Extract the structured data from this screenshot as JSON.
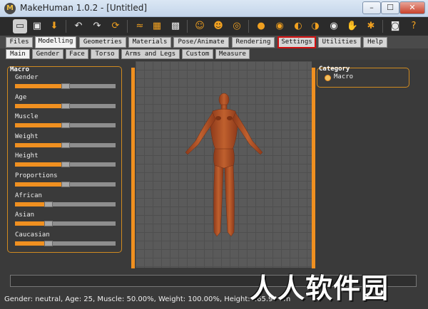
{
  "window": {
    "title": "MakeHuman 1.0.2 - [Untitled]",
    "min": "–",
    "max": "☐",
    "close": "✕"
  },
  "toolbar": {
    "icons": [
      "new-icon",
      "save-icon",
      "export-icon",
      "undo-icon",
      "redo-icon",
      "reset-icon",
      "wireframe-icon",
      "mesh-icon",
      "checker-icon",
      "front-view-icon",
      "side-view-icon",
      "top-view-icon",
      "head-icon",
      "face-icon",
      "ear-icon",
      "eye-icon",
      "hand-icon",
      "pose-icon",
      "camera-icon",
      "help-icon"
    ]
  },
  "main_tabs": [
    "Files",
    "Modelling",
    "Geometries",
    "Materials",
    "Pose/Animate",
    "Rendering",
    "Settings",
    "Utilities",
    "Help"
  ],
  "sub_tabs": [
    "Main",
    "Gender",
    "Face",
    "Torso",
    "Arms and Legs",
    "Custom",
    "Measure"
  ],
  "macro": {
    "title": "Macro",
    "sliders": [
      {
        "label": "Gender",
        "value": 0.5
      },
      {
        "label": "Age",
        "value": 0.5
      },
      {
        "label": "Muscle",
        "value": 0.5
      },
      {
        "label": "Weight",
        "value": 0.5
      },
      {
        "label": "Height",
        "value": 0.5
      },
      {
        "label": "Proportions",
        "value": 0.5
      },
      {
        "label": "African",
        "value": 0.33
      },
      {
        "label": "Asian",
        "value": 0.33
      },
      {
        "label": "Caucasian",
        "value": 0.33
      }
    ]
  },
  "category": {
    "title": "Category",
    "option": "Macro"
  },
  "status": "Gender: neutral, Age: 25, Muscle: 50.00%, Weight: 100.00%, Height: 165.94 cm",
  "watermark": "人人软件园",
  "colors": {
    "accent": "#f09020",
    "highlight": "#d01010",
    "skin": "#b5552c"
  }
}
